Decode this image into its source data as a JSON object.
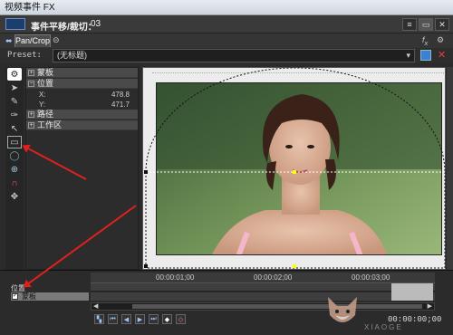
{
  "window": {
    "title": "视频事件 FX"
  },
  "header": {
    "title": "事件平移/裁切：",
    "number": "03"
  },
  "tabs": [
    {
      "label": "Pan/Crop"
    }
  ],
  "preset": {
    "label": "Preset:",
    "value": "(无标题)"
  },
  "properties": {
    "groups": [
      {
        "label": "蒙板",
        "expanded": false
      },
      {
        "label": "位置",
        "expanded": true,
        "rows": [
          {
            "label": "X:",
            "value": "478.8"
          },
          {
            "label": "Y:",
            "value": "471.7"
          }
        ]
      },
      {
        "label": "路径",
        "expanded": false
      },
      {
        "label": "工作区",
        "expanded": false
      }
    ]
  },
  "timeline": {
    "ticks": [
      "00:00:01;00",
      "00:00:02;00",
      "00:00:03;00"
    ],
    "tracks": [
      {
        "label": "位置"
      },
      {
        "label": "蒙板",
        "checked": true
      }
    ],
    "timecode": "00:00:00;00"
  },
  "watermark": {
    "text": "XIAOGE"
  },
  "colors": {
    "arrow": "#e0201f",
    "accent": "#4a8fe0",
    "selection": "#ffff00"
  }
}
